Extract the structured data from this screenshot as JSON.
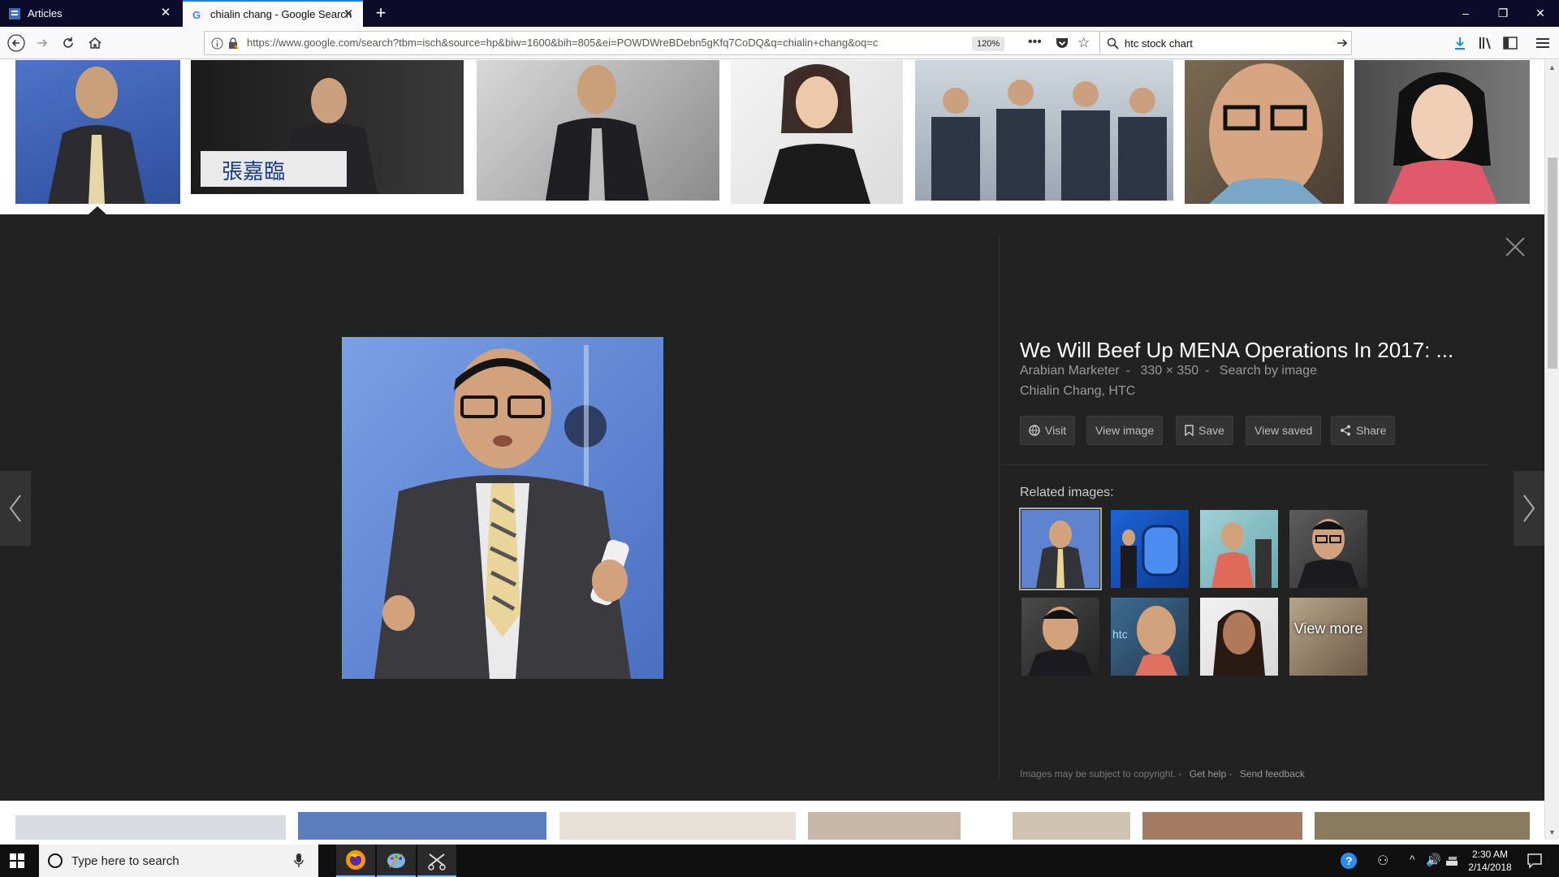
{
  "browser": {
    "tabs": [
      {
        "title": "Articles"
      },
      {
        "title": "chialin chang - Google Search"
      }
    ],
    "url": "https://www.google.com/search?tbm=isch&source=hp&biw=1600&bih=805&ei=POWDWreBDebn5gKfq7CoDQ&q=chialin+chang&oq=c",
    "zoom": "120%",
    "search_query": "htc stock chart"
  },
  "preview": {
    "title": "We Will Beef Up MENA Operations In 2017: ...",
    "source": "Arabian Marketer",
    "dimensions": "330 × 350",
    "search_by_image": "Search by image",
    "description": "Chialin Chang, HTC",
    "actions": {
      "visit": "Visit",
      "view_image": "View image",
      "save": "Save",
      "view_saved": "View saved",
      "share": "Share"
    },
    "related_label": "Related images:",
    "view_more": "View more",
    "footer": {
      "copyright": "Images may be subject to copyright.",
      "get_help": "Get help",
      "send_feedback": "Send feedback"
    }
  },
  "taskbar": {
    "search_placeholder": "Type here to search",
    "time": "2:30 AM",
    "date": "2/14/2018"
  }
}
